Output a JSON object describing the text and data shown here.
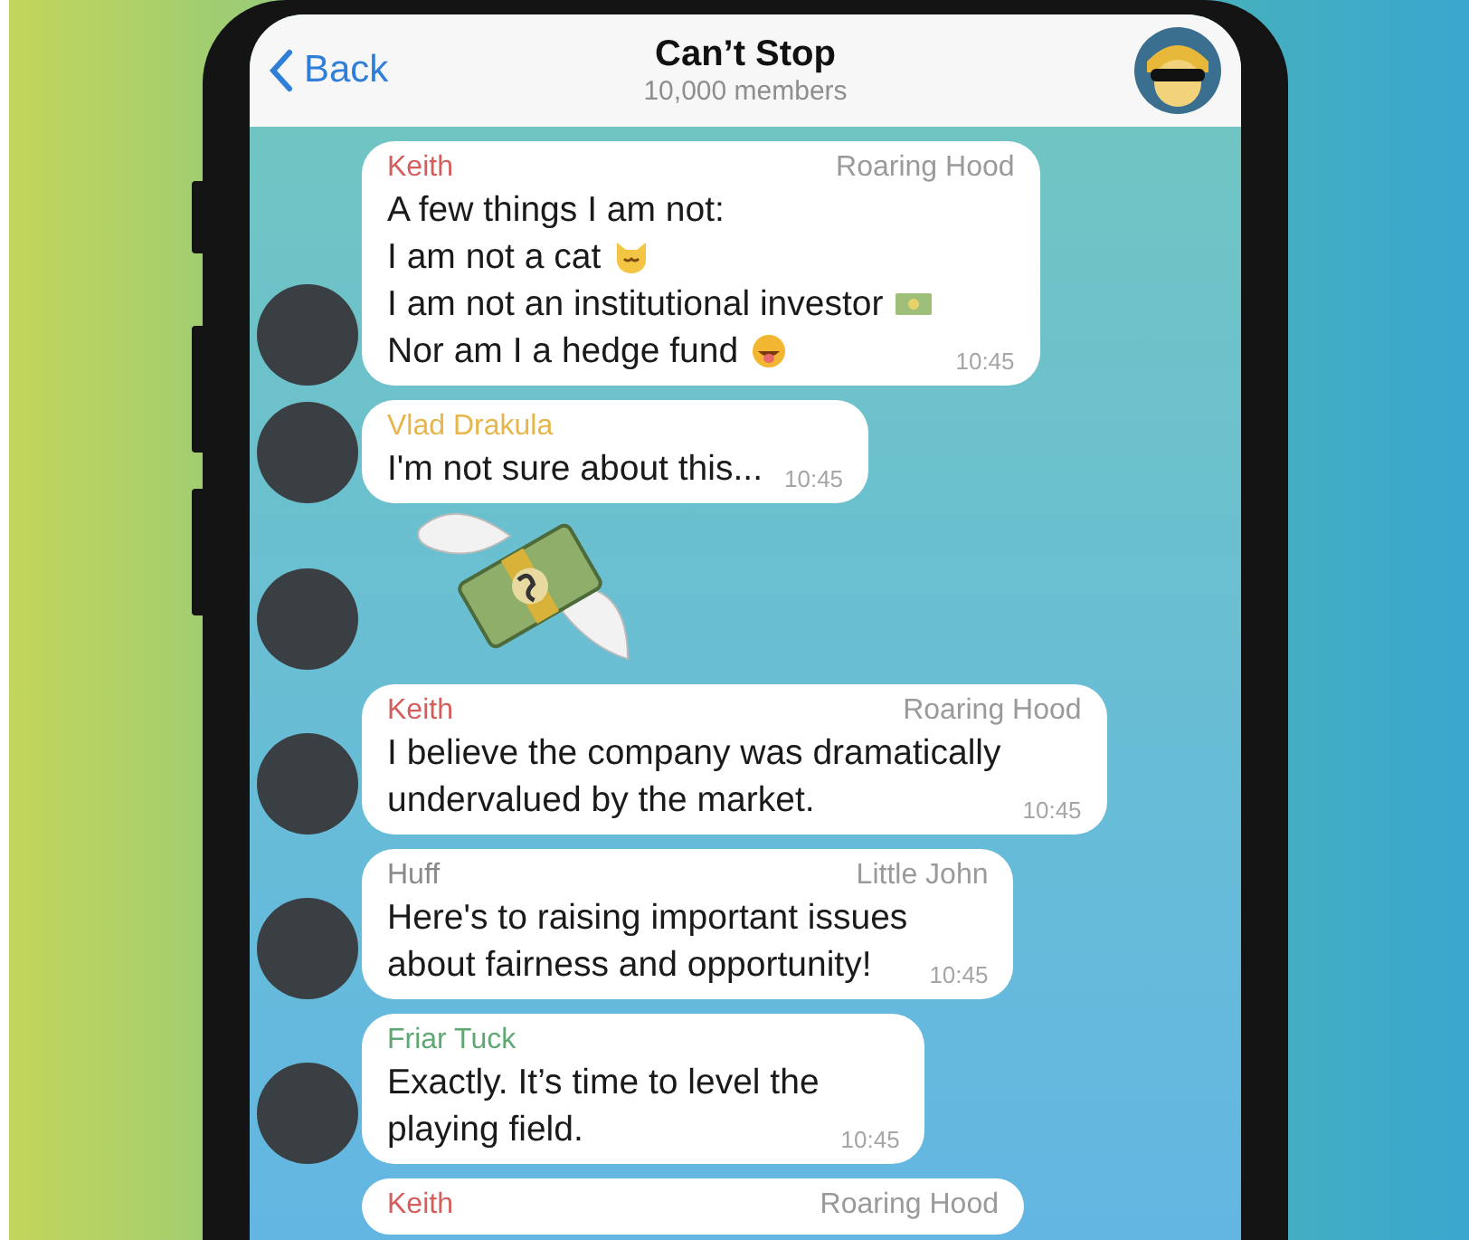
{
  "header": {
    "back": "Back",
    "title": "Can’t Stop",
    "subtitle": "10,000 members"
  },
  "messages": [
    {
      "kind": "message",
      "sender": "Keith",
      "color": "#d75c5c",
      "title": "Roaring Hood",
      "lines": [
        {
          "text": "A few things I am not:",
          "kind": "plain"
        },
        {
          "text": "I am not a cat",
          "kind": "cat"
        },
        {
          "text": "I am not an institutional investor",
          "kind": "money"
        },
        {
          "text": "Nor am I a hedge fund",
          "kind": "grin"
        }
      ],
      "time": "10:45",
      "avatar": true
    },
    {
      "kind": "message",
      "sender": "Vlad Drakula",
      "color": "#e6b64a",
      "lines": [
        {
          "text": "I'm not sure about this...",
          "kind": "plain"
        }
      ],
      "time": "10:45",
      "avatar": true
    },
    {
      "kind": "sticker",
      "avatar": true
    },
    {
      "kind": "message",
      "sender": "Keith",
      "color": "#d75c5c",
      "title": "Roaring Hood",
      "lines": [
        {
          "text": "I believe the company was dramatically",
          "kind": "plain"
        },
        {
          "text": "undervalued by the market.",
          "kind": "plain"
        }
      ],
      "time": "10:45",
      "avatar": true
    },
    {
      "kind": "message",
      "sender": "Huff",
      "color": "#8a8a8a",
      "title": "Little John",
      "lines": [
        {
          "text": "Here's to raising important issues",
          "kind": "plain"
        },
        {
          "text": "about fairness and opportunity!",
          "kind": "plain"
        }
      ],
      "time": "10:45",
      "avatar": true
    },
    {
      "kind": "message",
      "sender": "Friar Tuck",
      "color": "#5fa873",
      "lines": [
        {
          "text": "Exactly. It’s time to level the",
          "kind": "plain"
        },
        {
          "text": "playing field.",
          "kind": "plain"
        }
      ],
      "time": "10:45",
      "avatar": true
    },
    {
      "kind": "message",
      "sender": "Keith",
      "color": "#d75c5c",
      "title": "Roaring Hood",
      "avatar": false
    }
  ]
}
